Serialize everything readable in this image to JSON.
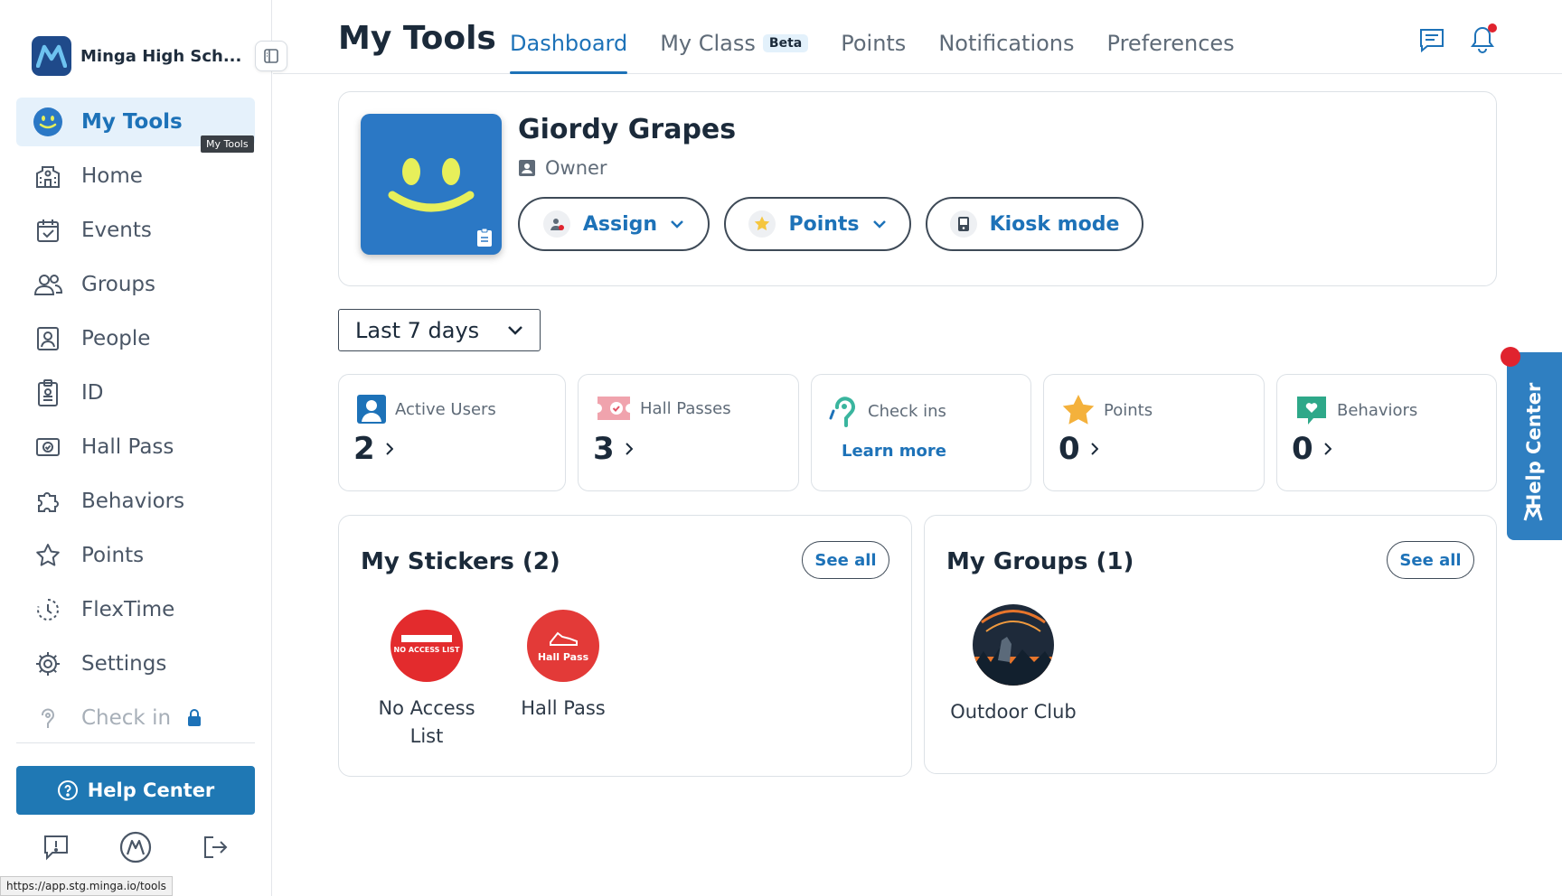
{
  "sidebar": {
    "school_name": "Minga High Sch...",
    "items": [
      {
        "label": "My Tools",
        "icon": "smiley-icon",
        "active": true
      },
      {
        "label": "Home",
        "icon": "school-building-icon"
      },
      {
        "label": "Events",
        "icon": "calendar-check-icon"
      },
      {
        "label": "Groups",
        "icon": "groups-icon"
      },
      {
        "label": "People",
        "icon": "person-card-icon"
      },
      {
        "label": "ID",
        "icon": "id-badge-icon"
      },
      {
        "label": "Hall Pass",
        "icon": "hall-pass-icon"
      },
      {
        "label": "Behaviors",
        "icon": "puzzle-icon"
      },
      {
        "label": "Points",
        "icon": "star-icon"
      },
      {
        "label": "FlexTime",
        "icon": "flextime-icon"
      },
      {
        "label": "Settings",
        "icon": "gear-icon"
      },
      {
        "label": "Check in",
        "icon": "check-in-icon",
        "locked": true
      }
    ],
    "tooltip": "My Tools",
    "help_center_label": "Help Center",
    "status_url": "https://app.stg.minga.io/tools"
  },
  "header": {
    "title": "My Tools",
    "tabs": [
      {
        "label": "Dashboard",
        "active": true
      },
      {
        "label": "My Class",
        "badge": "Beta"
      },
      {
        "label": "Points"
      },
      {
        "label": "Notifications"
      },
      {
        "label": "Preferences"
      }
    ]
  },
  "profile": {
    "name": "Giordy Grapes",
    "role": "Owner",
    "buttons": {
      "assign": "Assign",
      "points": "Points",
      "kiosk": "Kiosk mode"
    }
  },
  "range_select": {
    "value": "Last 7 days"
  },
  "stats": [
    {
      "label": "Active Users",
      "value": "2",
      "icon": "active-users-icon"
    },
    {
      "label": "Hall Passes",
      "value": "3",
      "icon": "hall-passes-icon"
    },
    {
      "label": "Check ins",
      "link": "Learn more",
      "icon": "check-ins-icon"
    },
    {
      "label": "Points",
      "value": "0",
      "icon": "points-star-icon"
    },
    {
      "label": "Behaviors",
      "value": "0",
      "icon": "behaviors-heart-icon"
    }
  ],
  "stickers": {
    "title": "My Stickers (2)",
    "see_all": "See all",
    "items": [
      {
        "label": "No Access List",
        "badge_text": "NO ACCESS LIST"
      },
      {
        "label": "Hall Pass",
        "badge_text": "Hall Pass"
      }
    ]
  },
  "groups": {
    "title": "My Groups (1)",
    "see_all": "See all",
    "items": [
      {
        "label": "Outdoor Club"
      }
    ]
  },
  "help_tab": {
    "label": "Help Center"
  },
  "colors": {
    "accent": "#1d72b8",
    "primary_button": "#1f78b4",
    "active_nav_bg": "#e5f1fb",
    "avatar_bg": "#2b78c5",
    "alert_red": "#e0232e",
    "text_dark": "#1b2a3a"
  }
}
